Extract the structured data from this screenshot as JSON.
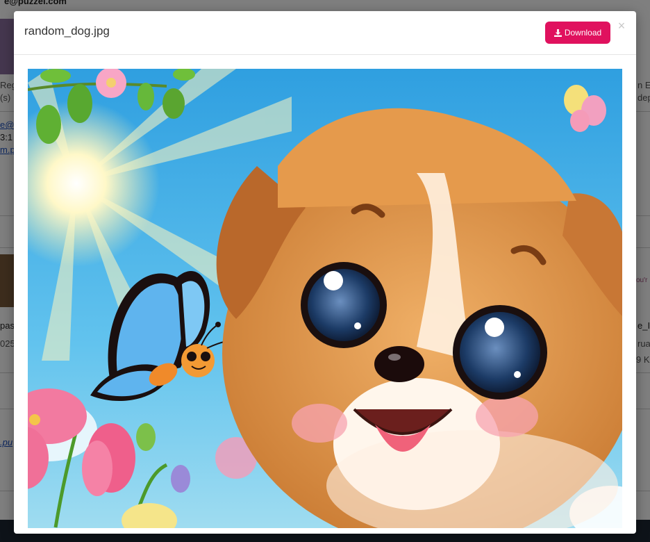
{
  "background": {
    "email": "e@puzzel.com",
    "fragments_left": [
      "Reg",
      "(s)",
      "e@",
      "3:1",
      "m.p",
      "past",
      "025",
      ".pu"
    ],
    "fragments_right": [
      "n E",
      "dep",
      "ou'r",
      "e_I",
      "ruar",
      "9 KE"
    ]
  },
  "modal": {
    "title": "random_dog.jpg",
    "download_label": "Download",
    "close_symbol": "×"
  },
  "image": {
    "subject": "random_dog.jpg"
  },
  "colors": {
    "accent": "#e0115e",
    "sky": "#3aaee8",
    "fur": "#d8893f"
  }
}
